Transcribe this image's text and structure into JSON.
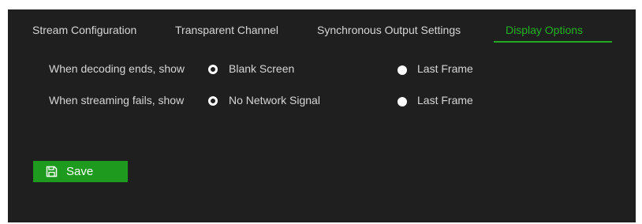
{
  "tabs": [
    {
      "label": "Stream Configuration",
      "active": false
    },
    {
      "label": "Transparent Channel",
      "active": false
    },
    {
      "label": "Synchronous Output Settings",
      "active": false
    },
    {
      "label": "Display Options",
      "active": true
    }
  ],
  "decoding_ends": {
    "label": "When decoding ends, show",
    "options": [
      "Blank Screen",
      "Last Frame"
    ],
    "selected": "Blank Screen"
  },
  "streaming_fails": {
    "label": "When streaming fails, show",
    "options": [
      "No Network Signal",
      "Last Frame"
    ],
    "selected": "No Network Signal"
  },
  "save_button": {
    "label": "Save",
    "icon": "floppy-disk-icon"
  },
  "colors": {
    "background": "#1f1f1f",
    "accent": "#22b322",
    "button": "#1e9a1e",
    "text": "#d6d6d6"
  }
}
